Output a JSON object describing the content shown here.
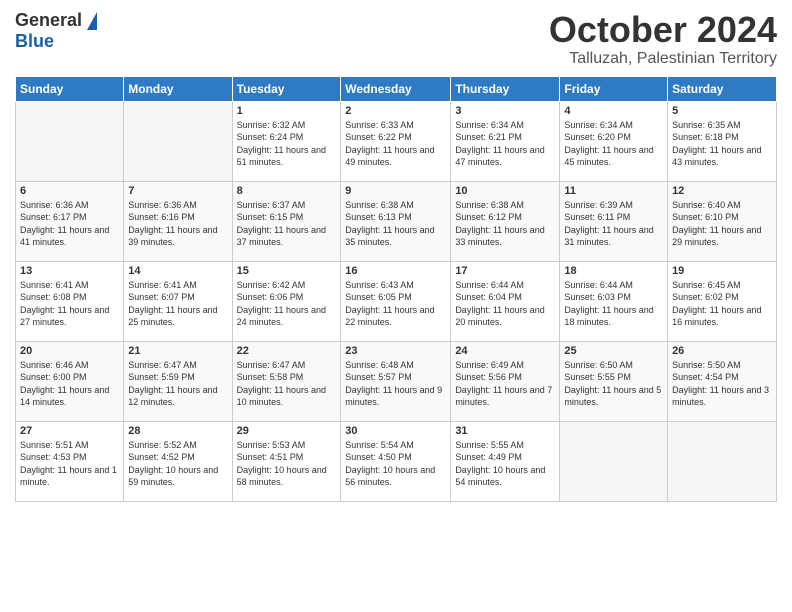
{
  "logo": {
    "general": "General",
    "blue": "Blue"
  },
  "title": {
    "month": "October 2024",
    "location": "Talluzah, Palestinian Territory"
  },
  "headers": [
    "Sunday",
    "Monday",
    "Tuesday",
    "Wednesday",
    "Thursday",
    "Friday",
    "Saturday"
  ],
  "weeks": [
    [
      {
        "day": "",
        "info": ""
      },
      {
        "day": "",
        "info": ""
      },
      {
        "day": "1",
        "info": "Sunrise: 6:32 AM\nSunset: 6:24 PM\nDaylight: 11 hours and 51 minutes."
      },
      {
        "day": "2",
        "info": "Sunrise: 6:33 AM\nSunset: 6:22 PM\nDaylight: 11 hours and 49 minutes."
      },
      {
        "day": "3",
        "info": "Sunrise: 6:34 AM\nSunset: 6:21 PM\nDaylight: 11 hours and 47 minutes."
      },
      {
        "day": "4",
        "info": "Sunrise: 6:34 AM\nSunset: 6:20 PM\nDaylight: 11 hours and 45 minutes."
      },
      {
        "day": "5",
        "info": "Sunrise: 6:35 AM\nSunset: 6:18 PM\nDaylight: 11 hours and 43 minutes."
      }
    ],
    [
      {
        "day": "6",
        "info": "Sunrise: 6:36 AM\nSunset: 6:17 PM\nDaylight: 11 hours and 41 minutes."
      },
      {
        "day": "7",
        "info": "Sunrise: 6:36 AM\nSunset: 6:16 PM\nDaylight: 11 hours and 39 minutes."
      },
      {
        "day": "8",
        "info": "Sunrise: 6:37 AM\nSunset: 6:15 PM\nDaylight: 11 hours and 37 minutes."
      },
      {
        "day": "9",
        "info": "Sunrise: 6:38 AM\nSunset: 6:13 PM\nDaylight: 11 hours and 35 minutes."
      },
      {
        "day": "10",
        "info": "Sunrise: 6:38 AM\nSunset: 6:12 PM\nDaylight: 11 hours and 33 minutes."
      },
      {
        "day": "11",
        "info": "Sunrise: 6:39 AM\nSunset: 6:11 PM\nDaylight: 11 hours and 31 minutes."
      },
      {
        "day": "12",
        "info": "Sunrise: 6:40 AM\nSunset: 6:10 PM\nDaylight: 11 hours and 29 minutes."
      }
    ],
    [
      {
        "day": "13",
        "info": "Sunrise: 6:41 AM\nSunset: 6:08 PM\nDaylight: 11 hours and 27 minutes."
      },
      {
        "day": "14",
        "info": "Sunrise: 6:41 AM\nSunset: 6:07 PM\nDaylight: 11 hours and 25 minutes."
      },
      {
        "day": "15",
        "info": "Sunrise: 6:42 AM\nSunset: 6:06 PM\nDaylight: 11 hours and 24 minutes."
      },
      {
        "day": "16",
        "info": "Sunrise: 6:43 AM\nSunset: 6:05 PM\nDaylight: 11 hours and 22 minutes."
      },
      {
        "day": "17",
        "info": "Sunrise: 6:44 AM\nSunset: 6:04 PM\nDaylight: 11 hours and 20 minutes."
      },
      {
        "day": "18",
        "info": "Sunrise: 6:44 AM\nSunset: 6:03 PM\nDaylight: 11 hours and 18 minutes."
      },
      {
        "day": "19",
        "info": "Sunrise: 6:45 AM\nSunset: 6:02 PM\nDaylight: 11 hours and 16 minutes."
      }
    ],
    [
      {
        "day": "20",
        "info": "Sunrise: 6:46 AM\nSunset: 6:00 PM\nDaylight: 11 hours and 14 minutes."
      },
      {
        "day": "21",
        "info": "Sunrise: 6:47 AM\nSunset: 5:59 PM\nDaylight: 11 hours and 12 minutes."
      },
      {
        "day": "22",
        "info": "Sunrise: 6:47 AM\nSunset: 5:58 PM\nDaylight: 11 hours and 10 minutes."
      },
      {
        "day": "23",
        "info": "Sunrise: 6:48 AM\nSunset: 5:57 PM\nDaylight: 11 hours and 9 minutes."
      },
      {
        "day": "24",
        "info": "Sunrise: 6:49 AM\nSunset: 5:56 PM\nDaylight: 11 hours and 7 minutes."
      },
      {
        "day": "25",
        "info": "Sunrise: 6:50 AM\nSunset: 5:55 PM\nDaylight: 11 hours and 5 minutes."
      },
      {
        "day": "26",
        "info": "Sunrise: 5:50 AM\nSunset: 4:54 PM\nDaylight: 11 hours and 3 minutes."
      }
    ],
    [
      {
        "day": "27",
        "info": "Sunrise: 5:51 AM\nSunset: 4:53 PM\nDaylight: 11 hours and 1 minute."
      },
      {
        "day": "28",
        "info": "Sunrise: 5:52 AM\nSunset: 4:52 PM\nDaylight: 10 hours and 59 minutes."
      },
      {
        "day": "29",
        "info": "Sunrise: 5:53 AM\nSunset: 4:51 PM\nDaylight: 10 hours and 58 minutes."
      },
      {
        "day": "30",
        "info": "Sunrise: 5:54 AM\nSunset: 4:50 PM\nDaylight: 10 hours and 56 minutes."
      },
      {
        "day": "31",
        "info": "Sunrise: 5:55 AM\nSunset: 4:49 PM\nDaylight: 10 hours and 54 minutes."
      },
      {
        "day": "",
        "info": ""
      },
      {
        "day": "",
        "info": ""
      }
    ]
  ]
}
